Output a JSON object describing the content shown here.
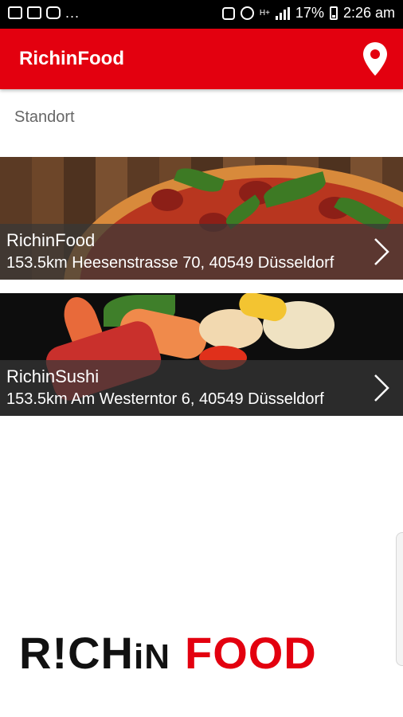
{
  "status_bar": {
    "left_icons": [
      "gmail-icon",
      "gallery-icon",
      "instagram-icon"
    ],
    "overflow": "...",
    "battery": "17%",
    "time": "2:26 am"
  },
  "app_bar": {
    "title": "RichinFood",
    "action_icon": "location-pin-icon"
  },
  "location_label": "Standort",
  "restaurants": [
    {
      "name": "RichinFood",
      "address": "153.5km Heesenstrasse 70, 40549 Düsseldorf",
      "image": "pizza"
    },
    {
      "name": "RichinSushi",
      "address": "153.5km Am Westerntor 6, 40549 Düsseldorf",
      "image": "sushi"
    }
  ],
  "logo": {
    "part1": "R!CH",
    "part2": "iN",
    "part3": "FOOD"
  },
  "colors": {
    "brand_red": "#e3000f",
    "status_bar": "#000000",
    "overlay": "#373737"
  }
}
